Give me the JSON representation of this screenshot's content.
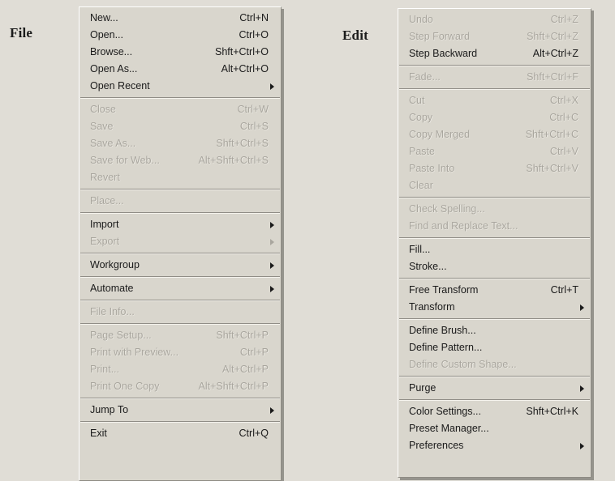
{
  "menubar": {
    "file_label": "File",
    "edit_label": "Edit"
  },
  "file_menu": {
    "name": "File",
    "groups": [
      {
        "items": [
          {
            "label": "New...",
            "accel": "Ctrl+N",
            "enabled": true,
            "submenu": false
          },
          {
            "label": "Open...",
            "accel": "Ctrl+O",
            "enabled": true,
            "submenu": false
          },
          {
            "label": "Browse...",
            "accel": "Shft+Ctrl+O",
            "enabled": true,
            "submenu": false
          },
          {
            "label": "Open As...",
            "accel": "Alt+Ctrl+O",
            "enabled": true,
            "submenu": false
          },
          {
            "label": "Open Recent",
            "accel": "",
            "enabled": true,
            "submenu": true
          }
        ]
      },
      {
        "items": [
          {
            "label": "Close",
            "accel": "Ctrl+W",
            "enabled": false,
            "submenu": false
          },
          {
            "label": "Save",
            "accel": "Ctrl+S",
            "enabled": false,
            "submenu": false
          },
          {
            "label": "Save As...",
            "accel": "Shft+Ctrl+S",
            "enabled": false,
            "submenu": false
          },
          {
            "label": "Save for Web...",
            "accel": "Alt+Shft+Ctrl+S",
            "enabled": false,
            "submenu": false
          },
          {
            "label": "Revert",
            "accel": "",
            "enabled": false,
            "submenu": false
          }
        ]
      },
      {
        "items": [
          {
            "label": "Place...",
            "accel": "",
            "enabled": false,
            "submenu": false
          }
        ]
      },
      {
        "items": [
          {
            "label": "Import",
            "accel": "",
            "enabled": true,
            "submenu": true
          },
          {
            "label": "Export",
            "accel": "",
            "enabled": false,
            "submenu": true
          }
        ]
      },
      {
        "items": [
          {
            "label": "Workgroup",
            "accel": "",
            "enabled": true,
            "submenu": true
          }
        ]
      },
      {
        "items": [
          {
            "label": "Automate",
            "accel": "",
            "enabled": true,
            "submenu": true
          }
        ]
      },
      {
        "items": [
          {
            "label": "File Info...",
            "accel": "",
            "enabled": false,
            "submenu": false
          }
        ]
      },
      {
        "items": [
          {
            "label": "Page Setup...",
            "accel": "Shft+Ctrl+P",
            "enabled": false,
            "submenu": false
          },
          {
            "label": "Print with Preview...",
            "accel": "Ctrl+P",
            "enabled": false,
            "submenu": false
          },
          {
            "label": "Print...",
            "accel": "Alt+Ctrl+P",
            "enabled": false,
            "submenu": false
          },
          {
            "label": "Print One Copy",
            "accel": "Alt+Shft+Ctrl+P",
            "enabled": false,
            "submenu": false
          }
        ]
      },
      {
        "items": [
          {
            "label": "Jump To",
            "accel": "",
            "enabled": true,
            "submenu": true
          }
        ]
      },
      {
        "items": [
          {
            "label": "Exit",
            "accel": "Ctrl+Q",
            "enabled": true,
            "submenu": false
          }
        ]
      }
    ]
  },
  "edit_menu": {
    "name": "Edit",
    "groups": [
      {
        "items": [
          {
            "label": "Undo",
            "accel": "Ctrl+Z",
            "enabled": false,
            "submenu": false
          },
          {
            "label": "Step Forward",
            "accel": "Shft+Ctrl+Z",
            "enabled": false,
            "submenu": false
          },
          {
            "label": "Step Backward",
            "accel": "Alt+Ctrl+Z",
            "enabled": true,
            "submenu": false
          }
        ]
      },
      {
        "items": [
          {
            "label": "Fade...",
            "accel": "Shft+Ctrl+F",
            "enabled": false,
            "submenu": false
          }
        ]
      },
      {
        "items": [
          {
            "label": "Cut",
            "accel": "Ctrl+X",
            "enabled": false,
            "submenu": false
          },
          {
            "label": "Copy",
            "accel": "Ctrl+C",
            "enabled": false,
            "submenu": false
          },
          {
            "label": "Copy Merged",
            "accel": "Shft+Ctrl+C",
            "enabled": false,
            "submenu": false
          },
          {
            "label": "Paste",
            "accel": "Ctrl+V",
            "enabled": false,
            "submenu": false
          },
          {
            "label": "Paste Into",
            "accel": "Shft+Ctrl+V",
            "enabled": false,
            "submenu": false
          },
          {
            "label": "Clear",
            "accel": "",
            "enabled": false,
            "submenu": false
          }
        ]
      },
      {
        "items": [
          {
            "label": "Check Spelling...",
            "accel": "",
            "enabled": false,
            "submenu": false
          },
          {
            "label": "Find and Replace Text...",
            "accel": "",
            "enabled": false,
            "submenu": false
          }
        ]
      },
      {
        "items": [
          {
            "label": "Fill...",
            "accel": "",
            "enabled": true,
            "submenu": false
          },
          {
            "label": "Stroke...",
            "accel": "",
            "enabled": true,
            "submenu": false
          }
        ]
      },
      {
        "items": [
          {
            "label": "Free Transform",
            "accel": "Ctrl+T",
            "enabled": true,
            "submenu": false
          },
          {
            "label": "Transform",
            "accel": "",
            "enabled": true,
            "submenu": true
          }
        ]
      },
      {
        "items": [
          {
            "label": "Define Brush...",
            "accel": "",
            "enabled": true,
            "submenu": false
          },
          {
            "label": "Define Pattern...",
            "accel": "",
            "enabled": true,
            "submenu": false
          },
          {
            "label": "Define Custom Shape...",
            "accel": "",
            "enabled": false,
            "submenu": false
          }
        ]
      },
      {
        "items": [
          {
            "label": "Purge",
            "accel": "",
            "enabled": true,
            "submenu": true
          }
        ]
      },
      {
        "items": [
          {
            "label": "Color Settings...",
            "accel": "Shft+Ctrl+K",
            "enabled": true,
            "submenu": false
          },
          {
            "label": "Preset Manager...",
            "accel": "",
            "enabled": true,
            "submenu": false
          },
          {
            "label": "Preferences",
            "accel": "",
            "enabled": true,
            "submenu": true
          }
        ]
      }
    ]
  }
}
